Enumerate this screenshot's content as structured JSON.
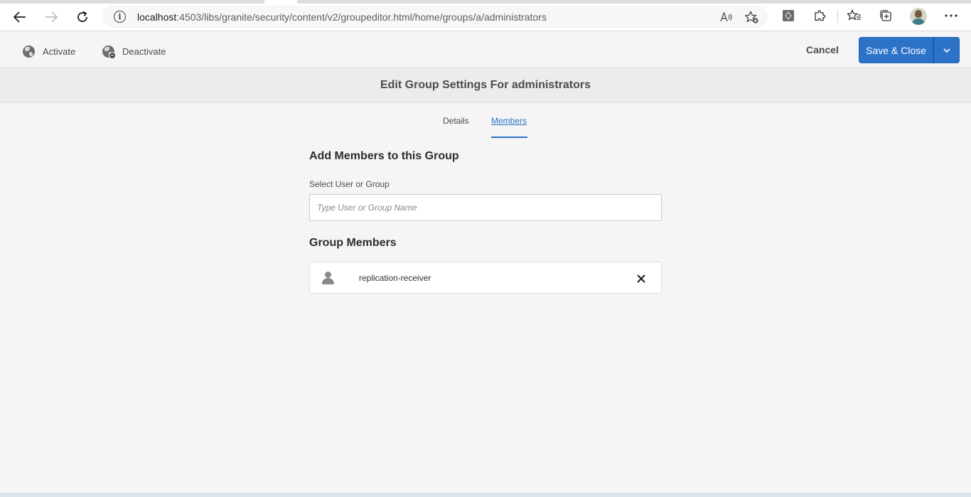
{
  "browser": {
    "url_host": "localhost",
    "url_rest": ":4503/libs/granite/security/content/v2/groupeditor.html/home/groups/a/administrators"
  },
  "actionbar": {
    "activate_label": "Activate",
    "deactivate_label": "Deactivate",
    "cancel_label": "Cancel",
    "save_label": "Save & Close"
  },
  "page": {
    "title": "Edit Group Settings For administrators"
  },
  "tabs": [
    {
      "label": "Details",
      "active": false
    },
    {
      "label": "Members",
      "active": true
    }
  ],
  "members_section": {
    "add_heading": "Add Members to this Group",
    "select_label": "Select User or Group",
    "select_placeholder": "Type User or Group Name",
    "select_value": "",
    "group_members_heading": "Group Members",
    "members": [
      {
        "name": "replication-receiver"
      }
    ]
  },
  "colors": {
    "accent": "#2c72c7",
    "background": "#f5f5f5"
  }
}
